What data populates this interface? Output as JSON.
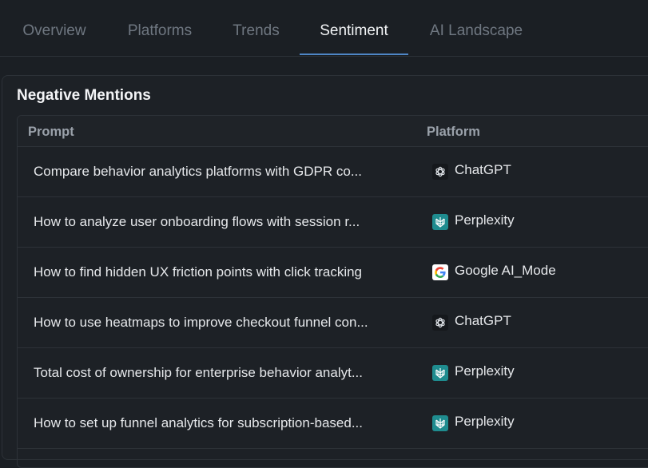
{
  "tabs": [
    {
      "label": "Overview"
    },
    {
      "label": "Platforms"
    },
    {
      "label": "Trends"
    },
    {
      "label": "Sentiment"
    },
    {
      "label": "AI Landscape"
    }
  ],
  "active_tab": "Sentiment",
  "panel": {
    "title": "Negative Mentions",
    "columns": {
      "prompt": "Prompt",
      "platform": "Platform"
    },
    "rows": [
      {
        "prompt": "Compare behavior analytics platforms with GDPR co...",
        "platform": "ChatGPT",
        "icon": "chatgpt-icon"
      },
      {
        "prompt": "How to analyze user onboarding flows with session r...",
        "platform": "Perplexity",
        "icon": "perplexity-icon"
      },
      {
        "prompt": "How to find hidden UX friction points with click tracking",
        "platform": "Google AI_Mode",
        "icon": "google-icon"
      },
      {
        "prompt": "How to use heatmaps to improve checkout funnel con...",
        "platform": "ChatGPT",
        "icon": "chatgpt-icon"
      },
      {
        "prompt": "Total cost of ownership for enterprise behavior analyt...",
        "platform": "Perplexity",
        "icon": "perplexity-icon"
      },
      {
        "prompt": "How to set up funnel analytics for subscription-based...",
        "platform": "Perplexity",
        "icon": "perplexity-icon"
      }
    ]
  },
  "colors": {
    "accent": "#4f86c6",
    "perplexity": "#1f8c8f",
    "background": "#1b1f24"
  }
}
